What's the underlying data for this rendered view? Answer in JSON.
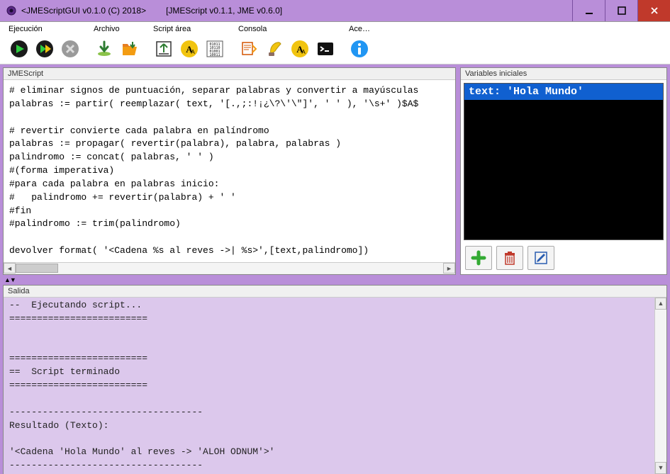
{
  "window": {
    "title1": "<JMEScriptGUI v0.1.0  (C) 2018>",
    "title2": "[JMEScript v0.1.1, JME v0.6.0]"
  },
  "toolbar": {
    "groups": {
      "ejecucion": "Ejecución",
      "archivo": "Archivo",
      "script_area": "Script área",
      "consola": "Consola",
      "ace": "Ace…"
    }
  },
  "panels": {
    "script_title": "JMEScript",
    "vars_title": "Variables iniciales",
    "output_title": "Salida"
  },
  "script_text": "# eliminar signos de puntuación, separar palabras y convertir a mayúsculas\npalabras := partir( reemplazar( text, '[.,;:!¡¿\\?\\'\\\"]', ' ' ), '\\s+' )$A$\n\n# revertir convierte cada palabra en palíndromo\npalabras := propagar( revertir(palabra), palabra, palabras )\npalindromo := concat( palabras, ' ' )\n#(forma imperativa)\n#para cada palabra en palabras inicio:\n#   palindromo += revertir(palabra) + ' '\n#fin\n#palindromo := trim(palindromo)\n\ndevolver format( '<Cadena %s al reves ->| %s>',[text,palindromo])",
  "vars": {
    "selected": "text: 'Hola Mundo'"
  },
  "splitter_glyph": "▲▼",
  "output_text": "--  Ejecutando script...\n=========================\n\n\n=========================\n==  Script terminado\n=========================\n\n-----------------------------------\nResultado (Texto):\n\n'<Cadena 'Hola Mundo' al reves -> 'ALOH ODNUM'>'\n-----------------------------------"
}
